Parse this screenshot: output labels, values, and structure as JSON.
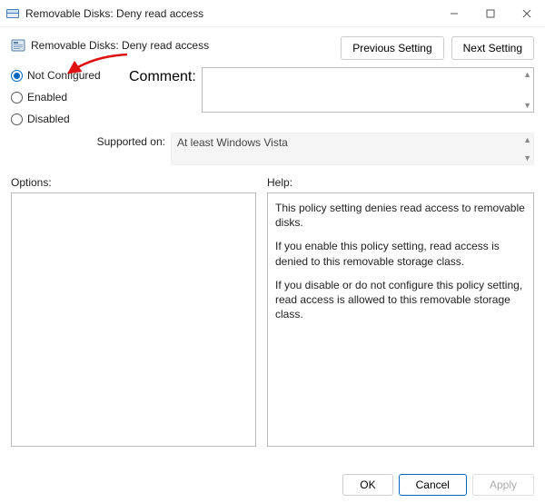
{
  "window": {
    "title": "Removable Disks: Deny read access"
  },
  "header": {
    "policy_name": "Removable Disks: Deny read access"
  },
  "nav": {
    "prev": "Previous Setting",
    "next": "Next Setting"
  },
  "state": {
    "not_configured": "Not Configured",
    "enabled": "Enabled",
    "disabled": "Disabled",
    "selected": "not_configured"
  },
  "labels": {
    "comment": "Comment:",
    "supported_on": "Supported on:",
    "options": "Options:",
    "help": "Help:"
  },
  "fields": {
    "comment_value": "",
    "supported_value": "At least Windows Vista"
  },
  "help": {
    "p1": "This policy setting denies read access to removable disks.",
    "p2": "If you enable this policy setting, read access is denied to this removable storage class.",
    "p3": "If you disable or do not configure this policy setting, read access is allowed to this removable storage class."
  },
  "footer": {
    "ok": "OK",
    "cancel": "Cancel",
    "apply": "Apply"
  }
}
